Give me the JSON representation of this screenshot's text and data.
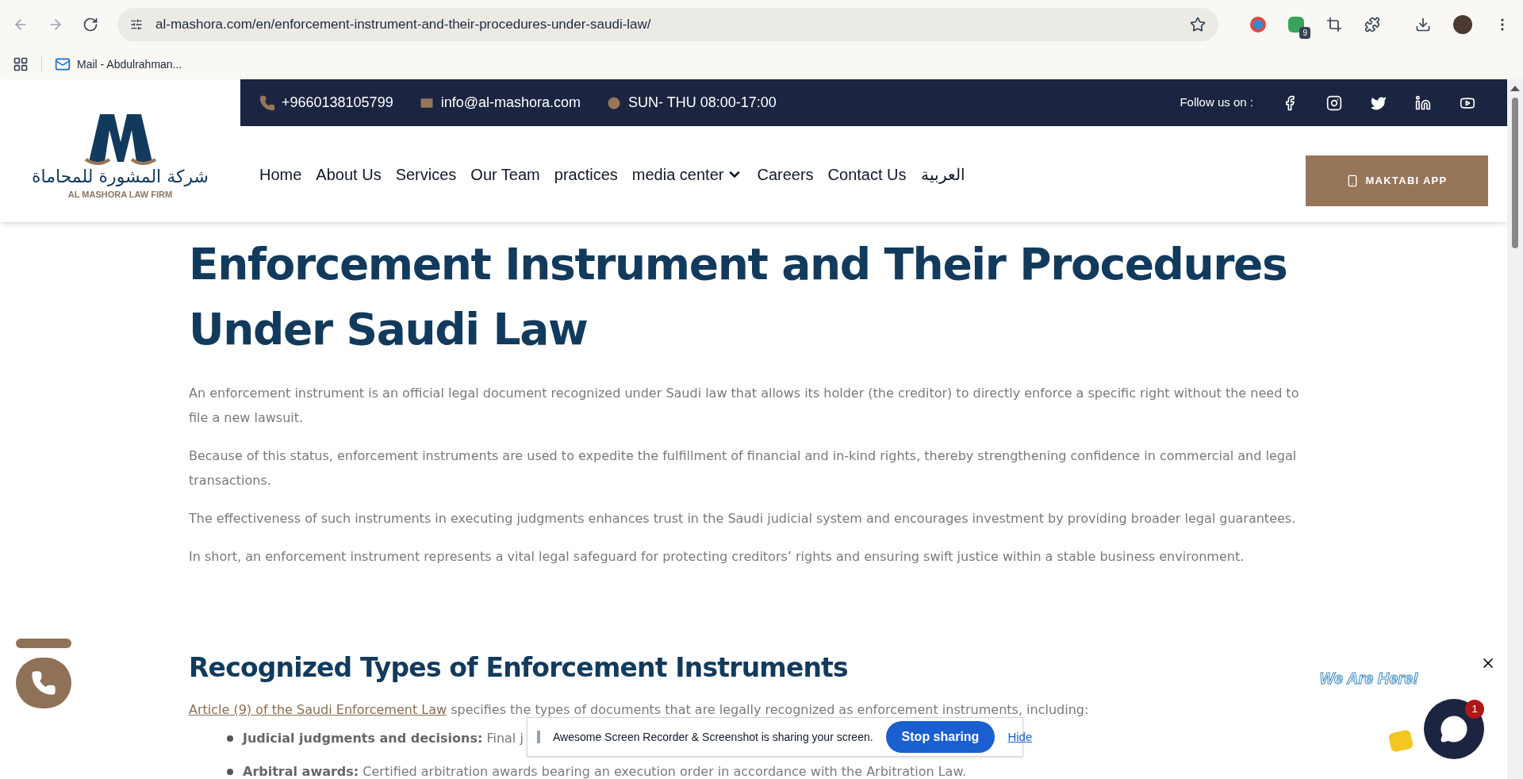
{
  "browser": {
    "url": "al-mashora.com/en/enforcement-instrument-and-their-procedures-under-saudi-law/",
    "extension_badge": "9",
    "bookmarks": [
      "Mail - Abdulrahman..."
    ]
  },
  "topbar": {
    "phone": "+9660138105799",
    "email": "info@al-mashora.com",
    "hours": "SUN- THU 08:00-17:00",
    "follow_label": "Follow us on :"
  },
  "logo": {
    "arabic": "شركة المشورة للمحاماة",
    "english": "AL MASHORA LAW FIRM"
  },
  "nav": [
    {
      "label": "Home",
      "dropdown": false
    },
    {
      "label": "About Us",
      "dropdown": false
    },
    {
      "label": "Services",
      "dropdown": false
    },
    {
      "label": "Our Team",
      "dropdown": false
    },
    {
      "label": "practices",
      "dropdown": false
    },
    {
      "label": "media center",
      "dropdown": true
    },
    {
      "label": "Careers",
      "dropdown": false
    },
    {
      "label": "Contact Us",
      "dropdown": false
    },
    {
      "label": "العربية",
      "dropdown": false
    }
  ],
  "app_button": "MAKTABI APP",
  "article": {
    "title": "Enforcement Instrument and Their Procedures Under Saudi Law",
    "paragraphs": [
      "An enforcement instrument is an official legal document recognized under Saudi law that allows its holder (the creditor) to directly enforce a specific right without the need to file a new lawsuit.",
      "Because of this status, enforcement instruments are used to expedite the fulfillment of financial and in-kind rights, thereby strengthening confidence in commercial and legal transactions.",
      "The effectiveness of such instruments in executing judgments enhances trust in the Saudi judicial system and encourages investment by providing broader legal guarantees.",
      "In short, an enforcement instrument represents a vital legal safeguard for protecting creditors’ rights and ensuring swift justice within a stable business environment."
    ],
    "section_title": "Recognized Types of Enforcement Instruments",
    "intro_link": "Article (9) of the Saudi Enforcement Law",
    "intro_text": " specifies the types of documents that are legally recognized as enforcement instruments, including:",
    "bullets": [
      {
        "term": "Judicial judgments and decisions:",
        "text": " Final j"
      },
      {
        "term": "Arbitral awards:",
        "text": " Certified arbitration awards bearing an execution order in accordance with the Arbitration Law."
      }
    ]
  },
  "share_bar": {
    "message": "Awesome Screen Recorder & Screenshot is sharing your screen.",
    "stop": "Stop sharing",
    "hide": "Hide"
  },
  "chat": {
    "greeting": "We Are Here!",
    "unread": "1"
  }
}
